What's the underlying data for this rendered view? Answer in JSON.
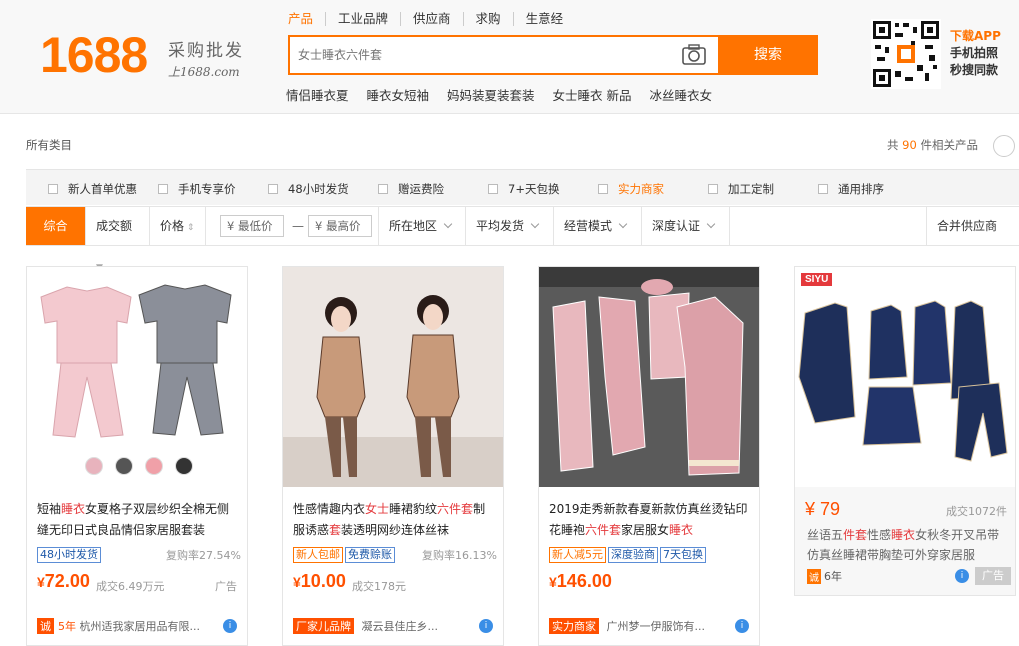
{
  "header": {
    "logo": "1688",
    "slogan_line1": "采购批发",
    "slogan_line2": "上1688.com",
    "search_tabs": [
      "产品",
      "工业品牌",
      "供应商",
      "求购",
      "生意经"
    ],
    "search_placeholder": "女士睡衣六件套",
    "search_button": "搜索",
    "hot_words": [
      "情侣睡衣夏",
      "睡衣女短袖",
      "妈妈装夏装套装",
      "女士睡衣 新品",
      "冰丝睡衣女"
    ],
    "app_line1": "下载APP",
    "app_line2": "手机拍照",
    "app_line3": "秒搜同款"
  },
  "category": {
    "label": "所有类目",
    "total_prefix": "共",
    "total_count": "90",
    "total_suffix": "件相关产品"
  },
  "filters": [
    "新人首单优惠",
    "手机专享价",
    "48小时发货",
    "赠运费险",
    "7+天包换",
    "实力商家",
    "加工定制",
    "通用排序"
  ],
  "sort": {
    "items": [
      "综合",
      "成交额",
      "价格"
    ],
    "min_price": "¥ 最低价",
    "max_price": "¥ 最高价",
    "dash": "—",
    "dropdowns": [
      "所在地区",
      "平均发货",
      "经营模式",
      "深度认证"
    ],
    "merge": "合并供应商"
  },
  "products": [
    {
      "title_parts": [
        [
          "短袖",
          ""
        ],
        [
          "睡衣",
          "r"
        ],
        [
          "女夏格子双层纱织全棉无侧缝无印日式良品情侣家居服套装",
          ""
        ]
      ],
      "tags": [
        "48小时发货"
      ],
      "rebuy": "复购率27.54%",
      "price_symbol": "¥",
      "price": "72.00",
      "sold": "成交6.49万元",
      "ad": "广告",
      "seller_badge": "诚",
      "seller_years": "5年",
      "seller": "杭州适我家居用品有限..."
    },
    {
      "title_parts": [
        [
          "性感情趣内衣",
          ""
        ],
        [
          "女士",
          "r"
        ],
        [
          "睡裙豹纹",
          ""
        ],
        [
          "六件套",
          "r"
        ],
        [
          "制服诱惑",
          ""
        ],
        [
          "套",
          "r"
        ],
        [
          "装透明网纱连体丝袜",
          ""
        ]
      ],
      "tags": [
        "新人包邮",
        "免费赊账"
      ],
      "rebuy": "复购率16.13%",
      "price_symbol": "¥",
      "price": "10.00",
      "sold": "成交178元",
      "seller_badge": "厂家儿品牌",
      "seller": "凝云县佳庄乡..."
    },
    {
      "title_parts": [
        [
          "2019走秀新款春夏新款仿真丝烫钻印花睡袍",
          ""
        ],
        [
          "六件套",
          "r"
        ],
        [
          "家居服女",
          ""
        ],
        [
          "睡衣",
          "r"
        ]
      ],
      "tags": [
        "新人减5元",
        "深度验商",
        "7天包换"
      ],
      "price_symbol": "¥",
      "price": "146.00",
      "seller_badge": "实力商家",
      "seller": "广州梦一伊服饰有..."
    }
  ],
  "product4": {
    "brand": "SIYU",
    "price": "¥ 79",
    "sold": "成交1072件",
    "title_parts": [
      [
        "丝语五",
        ""
      ],
      [
        "件套",
        "r"
      ],
      [
        "性感",
        ""
      ],
      [
        "睡衣",
        "r"
      ],
      [
        "女秋冬开叉吊带仿真丝睡裙带胸垫可外穿家居服",
        ""
      ]
    ],
    "years_badge": "诚",
    "years": "6年",
    "ad": "广告"
  },
  "colors": {
    "accent": "#ff7300",
    "price": "#ff5000",
    "highlight": "#e4393c",
    "tag_blue": "#1d58a8"
  }
}
